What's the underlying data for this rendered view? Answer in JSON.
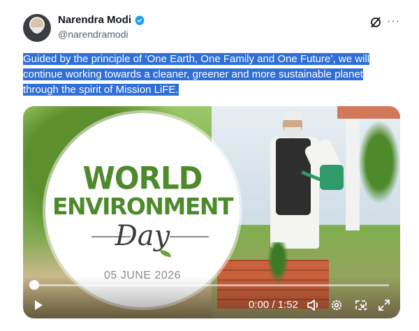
{
  "author": {
    "name": "Narendra Modi",
    "handle": "@narendramodi",
    "verified": true,
    "avatar_icon": "avatar"
  },
  "header_icons": [
    "grok-icon",
    "more-icon"
  ],
  "more_glyph": "···",
  "tweet": {
    "text": "Guided by the principle of ‘One Earth, One Family and One Future’, we will continue working towards a cleaner, greener and more sustainable planet through the spirit of Mission LiFE.",
    "highlight_color": "#2f6fd6"
  },
  "media": {
    "graphic": {
      "line1": "WORLD",
      "line2": "ENVIRONMENT",
      "line3": "Day",
      "date": "05 JUNE 2026",
      "accent": "#4e8a2c"
    },
    "video": {
      "time": "0:00 / 1:52",
      "progress": 0,
      "icons": [
        "play-icon",
        "volume-icon",
        "gear-icon",
        "picture-in-picture-icon",
        "fullscreen-icon"
      ]
    }
  },
  "colors": {
    "name": "#0f1419",
    "secondary": "#536471",
    "verified": "#1d9bf0"
  }
}
